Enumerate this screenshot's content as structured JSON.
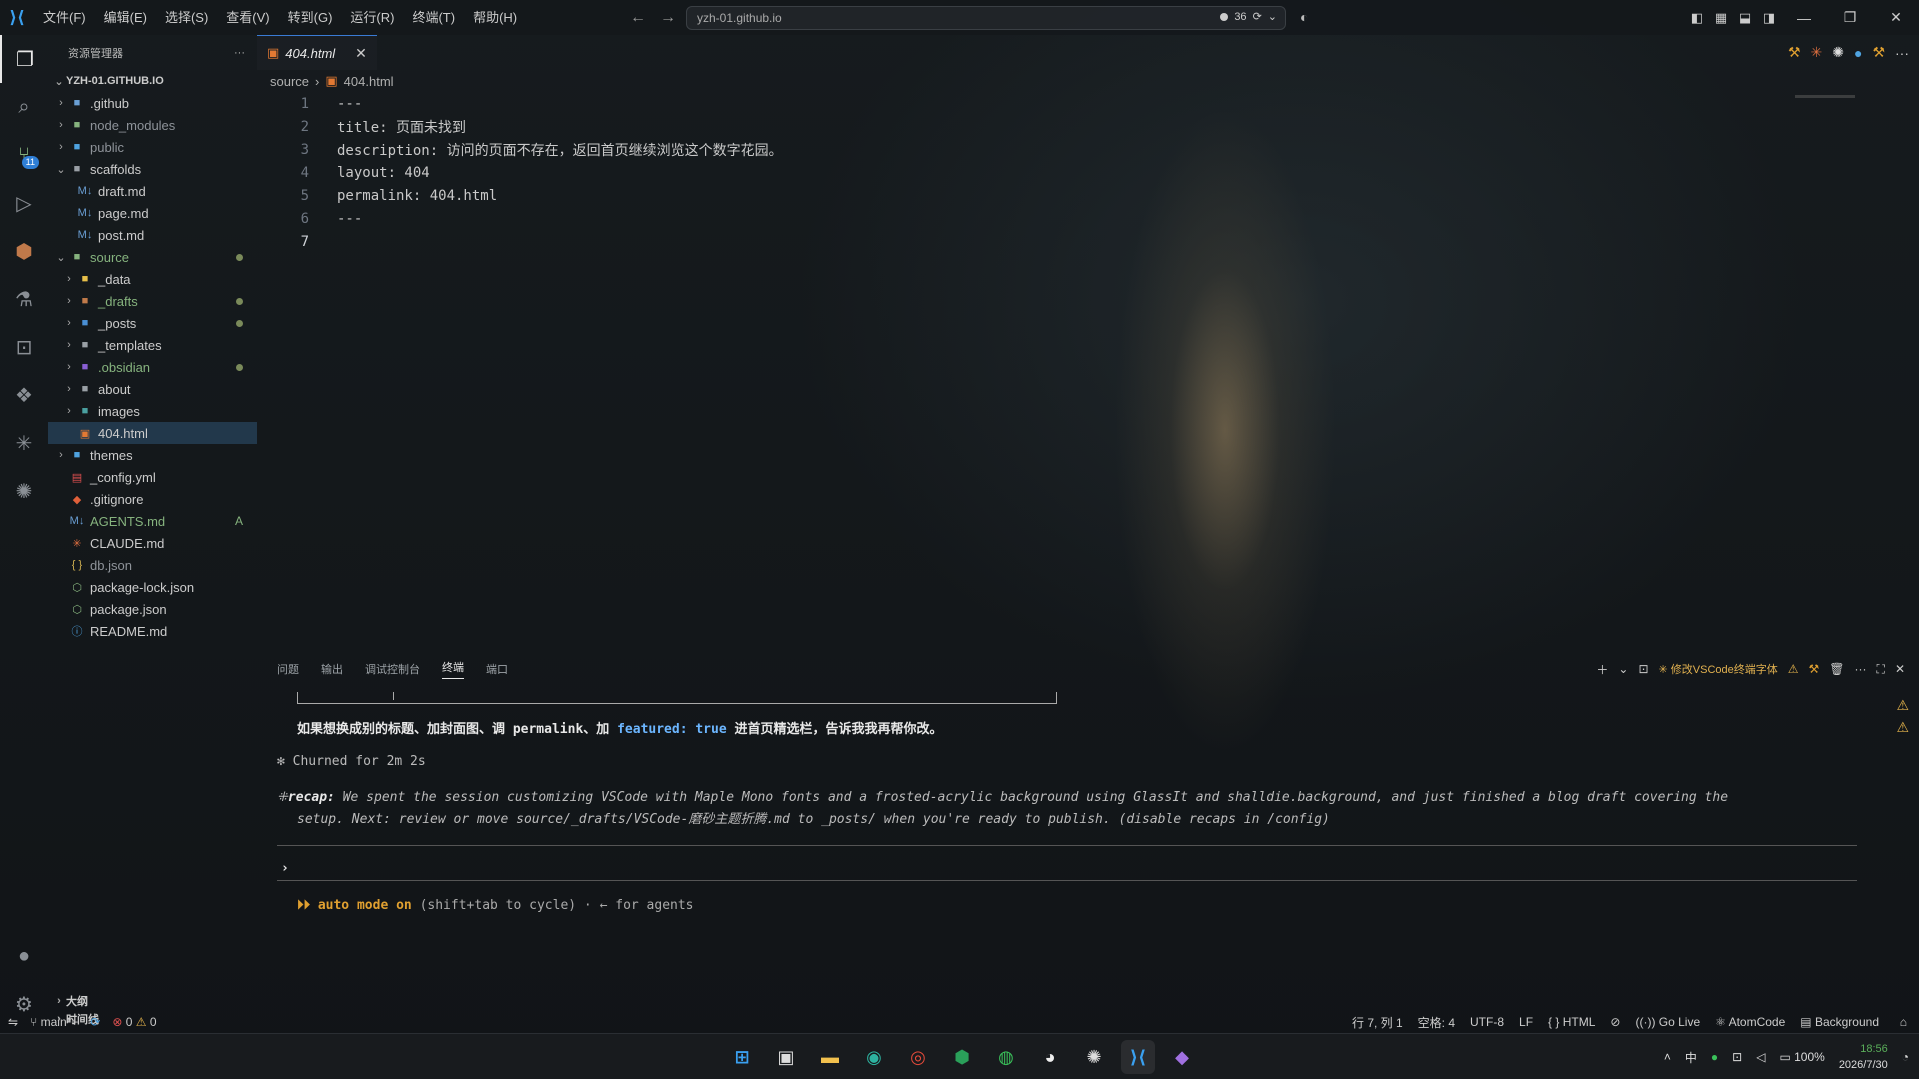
{
  "menu": [
    "文件(F)",
    "编辑(E)",
    "选择(S)",
    "查看(V)",
    "转到(G)",
    "运行(R)",
    "终端(T)",
    "帮助(H)"
  ],
  "command_center": {
    "text": "yzh-01.github.io",
    "count": "36"
  },
  "sidebar": {
    "title": "资源管理器",
    "root": "YZH-01.GITHUB.IO",
    "items": [
      {
        "label": ".github",
        "depth": 0,
        "type": "folder",
        "color": "#6a9fd4"
      },
      {
        "label": "node_modules",
        "depth": 0,
        "type": "folder",
        "color": "#86b37e",
        "dim": true
      },
      {
        "label": "public",
        "depth": 0,
        "type": "folder",
        "color": "#4fa3e0",
        "dim": true
      },
      {
        "label": "scaffolds",
        "depth": 0,
        "type": "folder-open",
        "color": "#9aa0a6"
      },
      {
        "label": "draft.md",
        "depth": 1,
        "type": "md"
      },
      {
        "label": "page.md",
        "depth": 1,
        "type": "md"
      },
      {
        "label": "post.md",
        "depth": 1,
        "type": "md"
      },
      {
        "label": "source",
        "depth": 0,
        "type": "folder-open",
        "color": "#86b37e",
        "status": "dot",
        "green": true
      },
      {
        "label": "_data",
        "depth": 1,
        "type": "folder",
        "color": "#e8c04a"
      },
      {
        "label": "_drafts",
        "depth": 1,
        "type": "folder",
        "color": "#c07a4a",
        "status": "dot",
        "green": true
      },
      {
        "label": "_posts",
        "depth": 1,
        "type": "folder",
        "color": "#4a8fd4",
        "status": "dot"
      },
      {
        "label": "_templates",
        "depth": 1,
        "type": "folder",
        "color": "#9aa0a6"
      },
      {
        "label": ".obsidian",
        "depth": 1,
        "type": "folder",
        "color": "#8a5fd4",
        "status": "dot",
        "green": true
      },
      {
        "label": "about",
        "depth": 1,
        "type": "folder",
        "color": "#9aa0a6"
      },
      {
        "label": "images",
        "depth": 1,
        "type": "folder",
        "color": "#4aa0a0"
      },
      {
        "label": "404.html",
        "depth": 1,
        "type": "html",
        "selected": true
      },
      {
        "label": "themes",
        "depth": 0,
        "type": "folder",
        "color": "#4fa3e0"
      },
      {
        "label": "_config.yml",
        "depth": 0,
        "type": "yml"
      },
      {
        "label": ".gitignore",
        "depth": 0,
        "type": "git"
      },
      {
        "label": "AGENTS.md",
        "depth": 0,
        "type": "md",
        "status": "A",
        "green": true
      },
      {
        "label": "CLAUDE.md",
        "depth": 0,
        "type": "claude"
      },
      {
        "label": "db.json",
        "depth": 0,
        "type": "json",
        "dim": true
      },
      {
        "label": "package-lock.json",
        "depth": 0,
        "type": "npm"
      },
      {
        "label": "package.json",
        "depth": 0,
        "type": "npm"
      },
      {
        "label": "README.md",
        "depth": 0,
        "type": "info"
      }
    ],
    "outline": "大纲",
    "timeline": "时间线"
  },
  "editor": {
    "tab": "404.html",
    "breadcrumb": [
      "source",
      "404.html"
    ],
    "lines": [
      {
        "n": "1",
        "text": "---"
      },
      {
        "n": "2",
        "text": "title: 页面未找到"
      },
      {
        "n": "3",
        "text": "description: 访问的页面不存在，返回首页继续浏览这个数字花园。"
      },
      {
        "n": "4",
        "text": "layout: 404"
      },
      {
        "n": "5",
        "text": "permalink: 404.html"
      },
      {
        "n": "6",
        "text": "---"
      },
      {
        "n": "7",
        "text": ""
      }
    ]
  },
  "panel": {
    "tabs": [
      "问题",
      "输出",
      "调试控制台",
      "终端",
      "端口"
    ],
    "active_tab": "终端",
    "terminal_name": "✳ 修改VSCode终端字体",
    "msg_a": "如果想换成别的标题、加封面图、调 permalink、加 ",
    "msg_kw": "featured: true",
    "msg_b": " 进首页精选栏，告诉我我再帮你改。",
    "churned": "✻ Churned for 2m 2s",
    "recap_label": "recap:",
    "recap_line1": " We spent the session customizing VSCode with Maple Mono fonts and a frosted-acrylic background using GlassIt and shalldie.background, and just finished a blog draft covering the",
    "recap_line2": "setup. Next: review or move source/_drafts/VSCode-磨砂主题折腾.md to _posts/ when you're ready to publish. (disable recaps in /config)",
    "prompt": "›",
    "auto_prefix": "⏵⏵ auto mode on",
    "auto_hint": " (shift+tab to cycle) · ← for agents"
  },
  "statusbar": {
    "branch": "main*+",
    "errors": "0",
    "warnings": "0",
    "position": "行 7, 列 1",
    "spaces": "空格: 4",
    "encoding": "UTF-8",
    "eol": "LF",
    "language": "HTML",
    "golive": "Go Live",
    "atomcode": "AtomCode",
    "background": "Background"
  },
  "taskbar": {
    "ime": "中",
    "battery": "100%",
    "time": "18:56",
    "date": "2026/7/30"
  }
}
